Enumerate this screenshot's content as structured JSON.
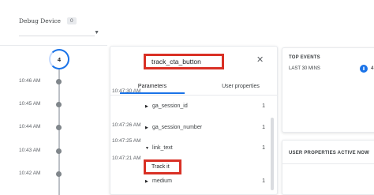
{
  "debug_device": {
    "label": "Debug Device",
    "count": "0",
    "dropdown_value": ""
  },
  "timeline": {
    "event_count": "4",
    "times": [
      "10:46 AM",
      "10:45 AM",
      "10:44 AM",
      "10:43 AM",
      "10:42 AM"
    ]
  },
  "event_panel": {
    "event_name": "track_cta_button",
    "close_icon": "close-icon",
    "tabs": [
      "Parameters",
      "User properties"
    ],
    "timestamps": [
      "10:47:30 AM",
      "10:47:26 AM",
      "10:47:25 AM",
      "10:47:21 AM"
    ],
    "params": [
      {
        "name": "ga_session_id",
        "count": "1",
        "expanded": false
      },
      {
        "name": "ga_session_number",
        "count": "1",
        "expanded": false
      },
      {
        "name": "link_text",
        "count": "1",
        "expanded": true
      },
      {
        "name": "medium",
        "count": "1",
        "expanded": false
      }
    ],
    "link_text_value": "Track it"
  },
  "top_events": {
    "title": "TOP EVENTS",
    "subtitle": "LAST 30 MINS",
    "count": "4",
    "icon": "event-icon"
  },
  "user_properties": {
    "title": "USER PROPERTIES ACTIVE NOW"
  },
  "colors": {
    "accent": "#1a73e8",
    "highlight": "#d93025",
    "dot": "#80868b"
  }
}
